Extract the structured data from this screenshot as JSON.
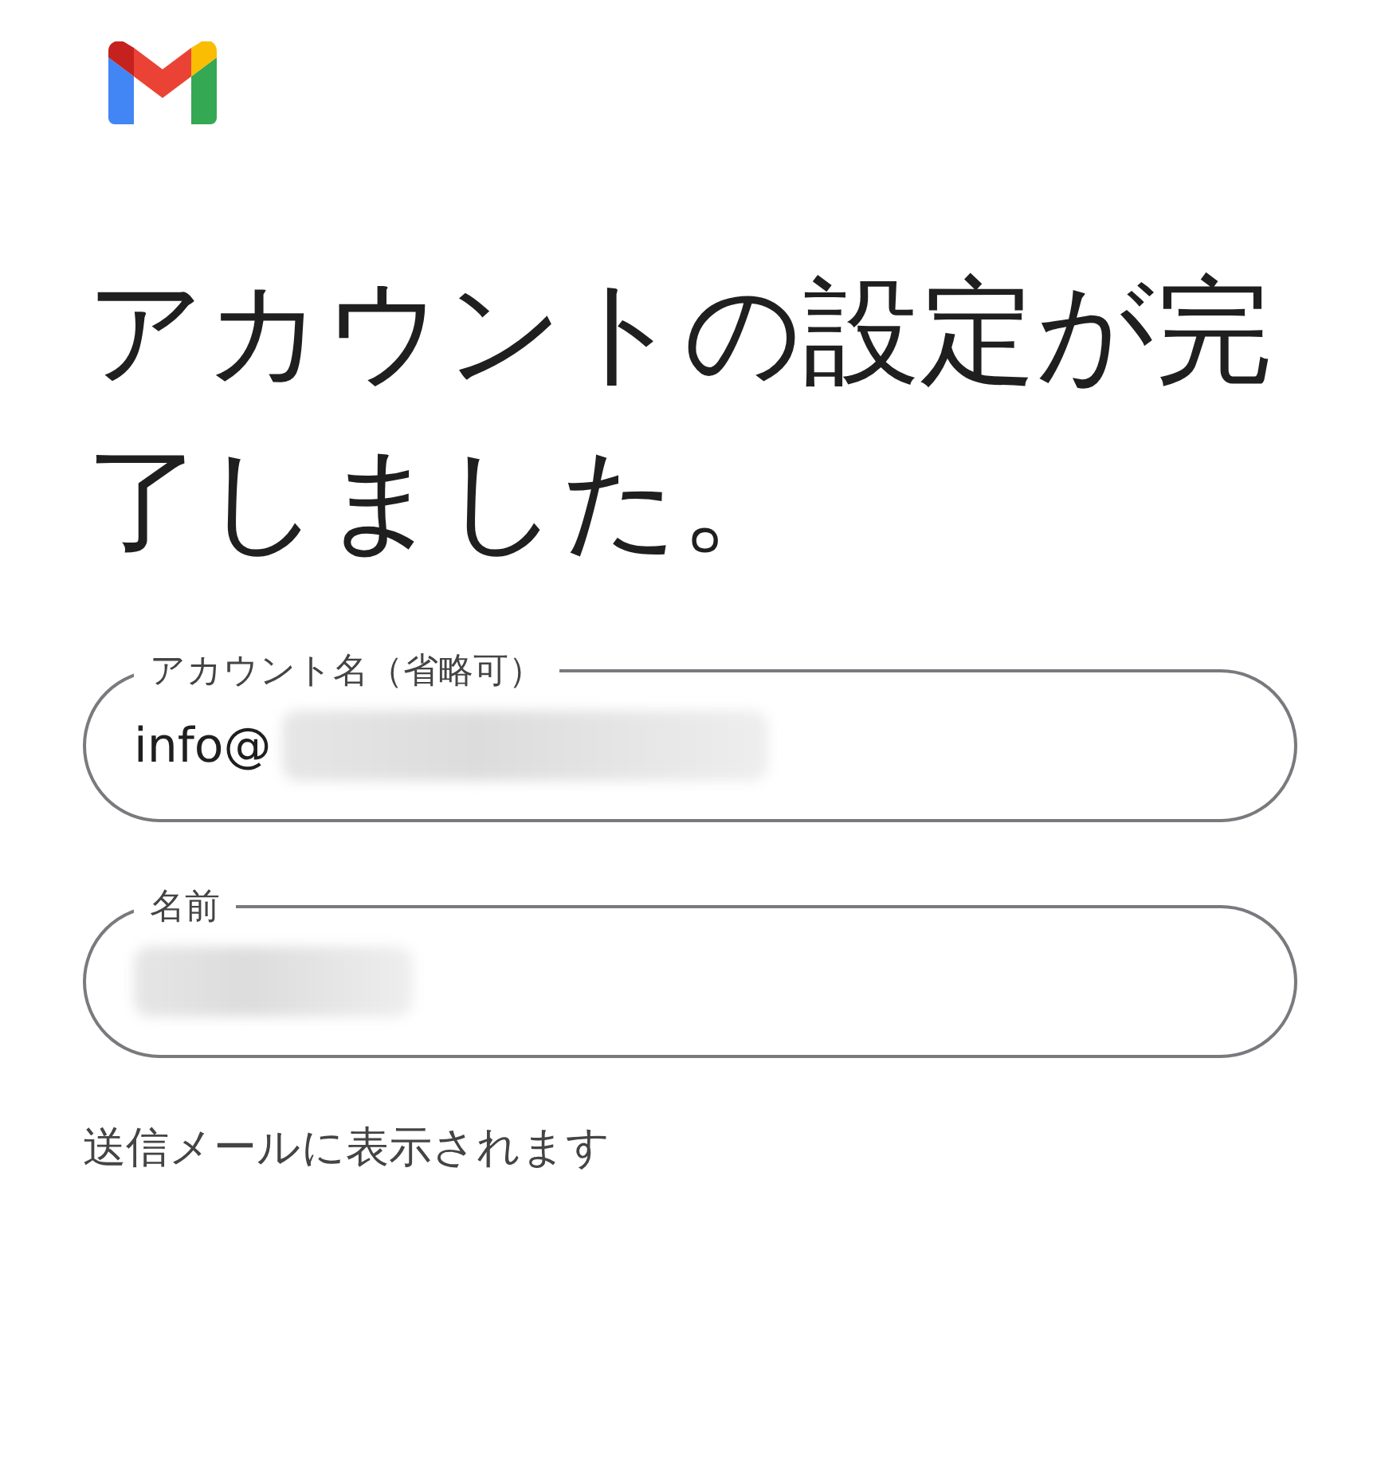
{
  "heading": "アカウントの設定が完了しました。",
  "fields": [
    {
      "label": "アカウント名（省略可）",
      "value": "info@",
      "redacted": true
    },
    {
      "label": "名前",
      "redacted": true
    }
  ],
  "helper_text": "送信メールに表示されます"
}
